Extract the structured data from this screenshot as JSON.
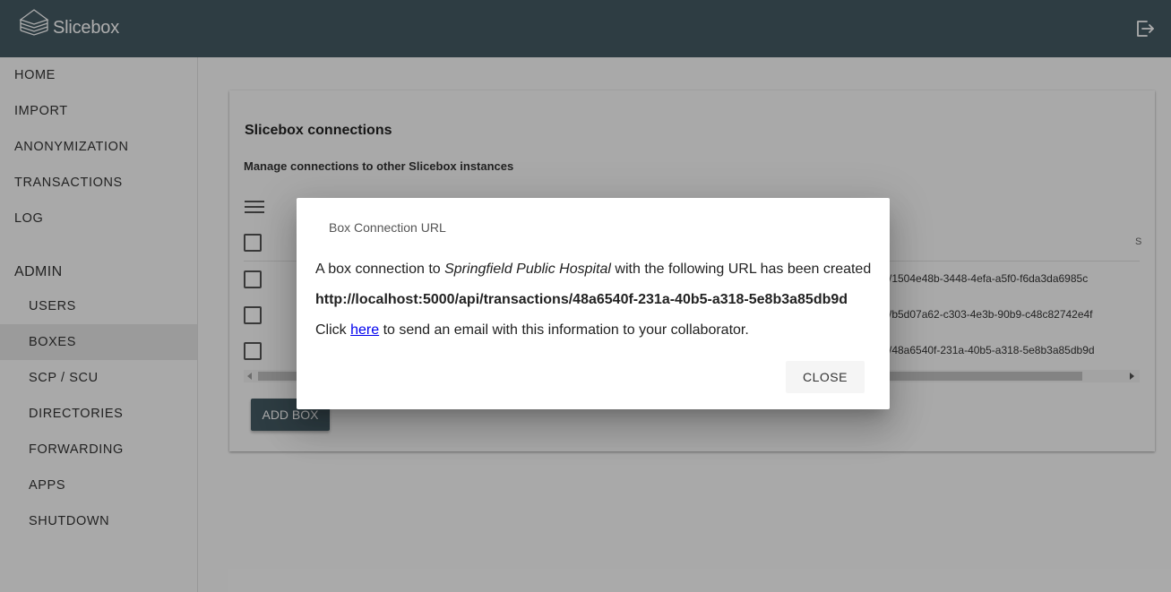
{
  "app": {
    "brand": "Slicebox"
  },
  "icons": {
    "logo": "stacked-slices-logo-icon",
    "logout": "logout-icon",
    "menu": "hamburger-menu-icon"
  },
  "colors": {
    "topbar": "#455a64",
    "accent_button": "#455a64",
    "active_nav": "#e5e5e5"
  },
  "sidebar": {
    "main_items": [
      {
        "label": "HOME"
      },
      {
        "label": "IMPORT"
      },
      {
        "label": "ANONYMIZATION"
      },
      {
        "label": "TRANSACTIONS"
      },
      {
        "label": "LOG"
      }
    ],
    "admin_header": "ADMIN",
    "admin_items": [
      {
        "label": "USERS"
      },
      {
        "label": "BOXES",
        "active": true
      },
      {
        "label": "SCP / SCU"
      },
      {
        "label": "DIRECTORIES"
      },
      {
        "label": "FORWARDING"
      },
      {
        "label": "APPS"
      },
      {
        "label": "SHUTDOWN"
      }
    ]
  },
  "main": {
    "title": "Slicebox connections",
    "subtitle": "Manage connections to other Slicebox instances",
    "column_head_partial": "S",
    "rows": [
      {
        "url_fragment": "/1504e48b-3448-4efa-a5f0-f6da3da6985c"
      },
      {
        "url_fragment": "/b5d07a62-c303-4e3b-90b9-c48c82742e4f"
      },
      {
        "url_fragment": "/48a6540f-231a-40b5-a318-5e8b3a85db9d"
      }
    ],
    "add_button": "ADD BOX"
  },
  "dialog": {
    "title": "Box Connection URL",
    "line1_pre": "A box connection to ",
    "box_name": "Springfield Public Hospital",
    "line1_post": " with the following URL has been created",
    "url": "http://localhost:5000/api/transactions/48a6540f-231a-40b5-a318-5e8b3a85db9d",
    "line3_pre": "Click ",
    "link_text": "here",
    "line3_post": " to send an email with this information to your collaborator.",
    "close_label": "CLOSE"
  }
}
